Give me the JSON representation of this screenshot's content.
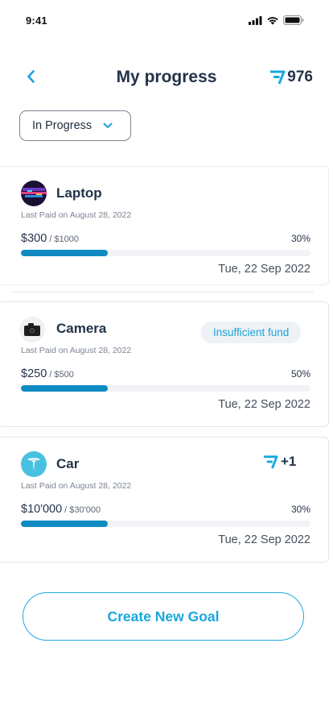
{
  "status_bar": {
    "time": "9:41"
  },
  "header": {
    "title": "My progress",
    "points": "976"
  },
  "filter": {
    "selected": "In Progress"
  },
  "goals": [
    {
      "name": "Laptop",
      "last_paid": "Last Paid on August 28, 2022",
      "saved": "$300",
      "target": "/ $1000",
      "percent_label": "30%",
      "date": "Tue, 22 Sep 2022",
      "avatar_icon": "laptop-icon"
    },
    {
      "name": "Camera",
      "last_paid": "Last Paid on August 28, 2022",
      "saved": "$250",
      "target": "/ $500",
      "percent_label": "50%",
      "date": "Tue, 22 Sep 2022",
      "badge": "Insufficient fund",
      "avatar_icon": "camera-icon"
    },
    {
      "name": "Car",
      "last_paid": "Last Paid on August 28, 2022",
      "saved": "$10'000",
      "target": "/ $30'000",
      "percent_label": "30%",
      "date": "Tue, 22 Sep 2022",
      "reward": "+1",
      "avatar_icon": "tesla-logo-icon"
    }
  ],
  "progress_fractions": [
    0.3,
    0.3,
    0.3
  ],
  "actions": {
    "create_label": "Create New Goal"
  },
  "colors": {
    "accent": "#16a7e0",
    "progress": "#0f8bc2",
    "text_dark": "#23334a"
  }
}
